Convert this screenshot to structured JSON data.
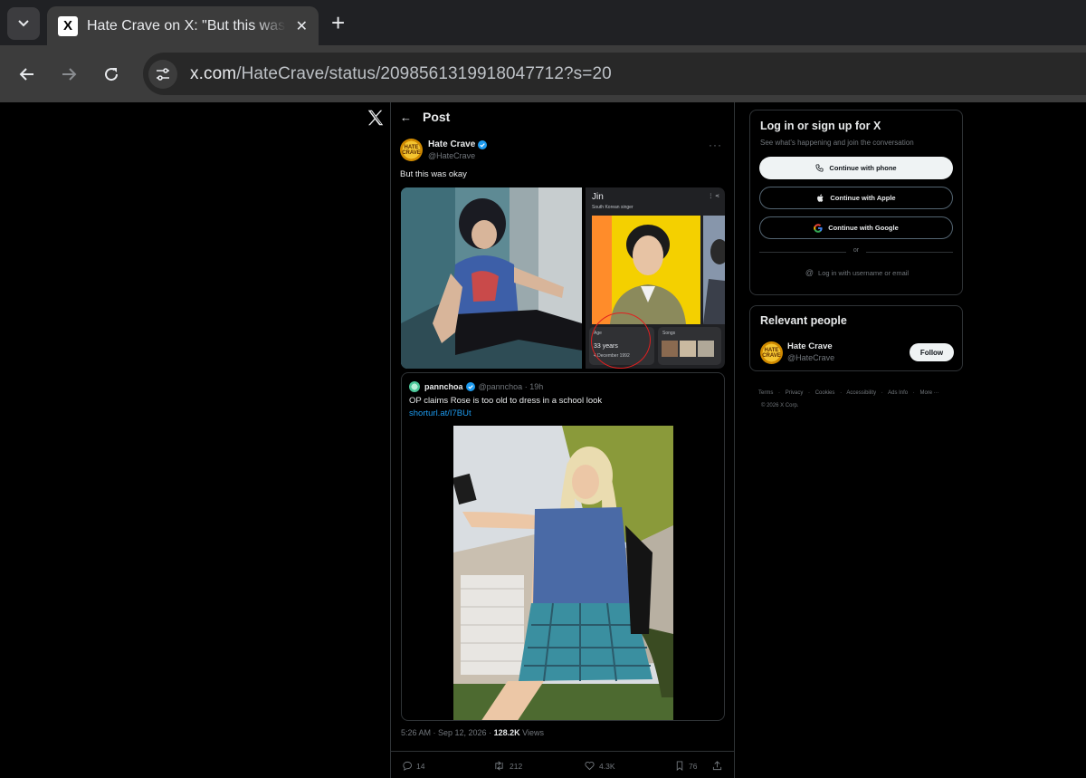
{
  "browser": {
    "tab_title": "Hate Crave on X: \"But this was o",
    "tab_favicon": "X",
    "tab_close": "✕",
    "new_tab": "+",
    "url_host": "x.com",
    "url_path": "/HateCrave/status/2098561319918047712?s=20"
  },
  "header": {
    "title": "Post",
    "back": "←"
  },
  "post": {
    "author_name": "Hate Crave",
    "author_handle": "@HateCrave",
    "avatar_text": "HATE CRAVE",
    "text": "But this was okay",
    "more": "···",
    "timestamp": "5:26 AM · Sep 12, 2026 · ",
    "views_count": "128.2K",
    "views_label": " Views"
  },
  "search_card": {
    "title": "Jin",
    "subtitle": "South Korean singer",
    "age_label": "Age",
    "age_value": "33 years",
    "age_date": "4 December 1992",
    "songs_label": "Songs"
  },
  "quote": {
    "author_name": "pannchoa",
    "author_meta": "@pannchoa · 19h",
    "text": "OP claims Rose is too old to dress in a school look",
    "link": "shorturl.at/I7BUt"
  },
  "actions": {
    "replies": "14",
    "reposts": "212",
    "likes": "4.3K",
    "bookmarks": "76"
  },
  "signup": {
    "title": "Log in or sign up for X",
    "subtitle": "See what's happening and join the conversation",
    "phone": "Continue with phone",
    "apple": "Continue with Apple",
    "google": "Continue with Google",
    "or": "or",
    "username": "Log in with username or email"
  },
  "relevant": {
    "title": "Relevant people",
    "name": "Hate Crave",
    "handle": "@HateCrave",
    "follow": "Follow"
  },
  "footer": {
    "links": [
      "Terms",
      "·",
      "Privacy",
      "·",
      "Cookies",
      "·",
      "Accessibility",
      "·",
      "Ads Info",
      "·",
      "More ···"
    ],
    "copyright": "© 2026 X Corp."
  },
  "colors": {
    "accent_blue": "#1d9bf0",
    "background": "#000000",
    "border": "#2f3336",
    "muted_text": "#71767b"
  }
}
